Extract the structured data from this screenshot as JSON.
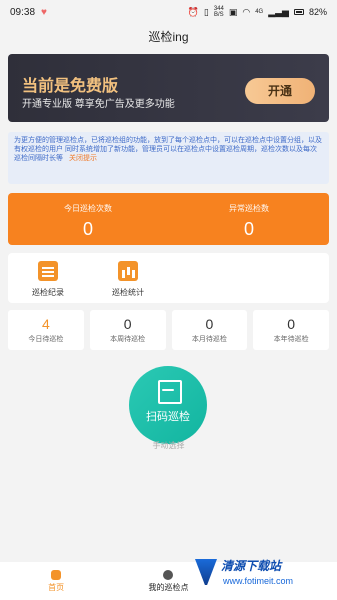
{
  "status_bar": {
    "time": "09:38",
    "net_speed": "344",
    "net_unit": "B/S",
    "signal_label": "4G",
    "battery_percent": "82%"
  },
  "app": {
    "title": "巡检ing"
  },
  "promo": {
    "title": "当前是免费版",
    "subtitle": "开通专业版 尊享免广告及更多功能",
    "button": "开通"
  },
  "notice": {
    "text": "为更方便的管理巡检点，已将巡检组的功能，放到了每个巡检点中，可以在巡检点中设置分组，以及有权巡检的用户 同时系统增加了新功能，管理员可以在巡检点中设置巡检周期，巡检次数以及每次巡检间隔时长等",
    "close": "关闭提示"
  },
  "stats": {
    "today_label": "今日巡检次数",
    "today_value": "0",
    "abnormal_label": "异常巡检数",
    "abnormal_value": "0"
  },
  "shortcuts": [
    {
      "label": "巡检纪录",
      "icon": "record-icon"
    },
    {
      "label": "巡检统计",
      "icon": "stats-icon"
    }
  ],
  "counts": [
    {
      "value": "4",
      "label": "今日待巡检"
    },
    {
      "value": "0",
      "label": "本周待巡检"
    },
    {
      "value": "0",
      "label": "本月待巡检"
    },
    {
      "value": "0",
      "label": "本年待巡检"
    }
  ],
  "scan": {
    "label": "扫码巡检",
    "manual": "手动选择"
  },
  "tabs": [
    {
      "label": "首页",
      "icon": "home-icon"
    },
    {
      "label": "我的巡检点",
      "icon": "checkpoint-icon"
    }
  ],
  "watermark": {
    "brand": "清源下载站",
    "url": "www.fotimeit.com"
  },
  "colors": {
    "accent": "#f7821f",
    "scan": "#19bca7",
    "promo_bg": "#34343f",
    "gold": "#f2c17f"
  }
}
